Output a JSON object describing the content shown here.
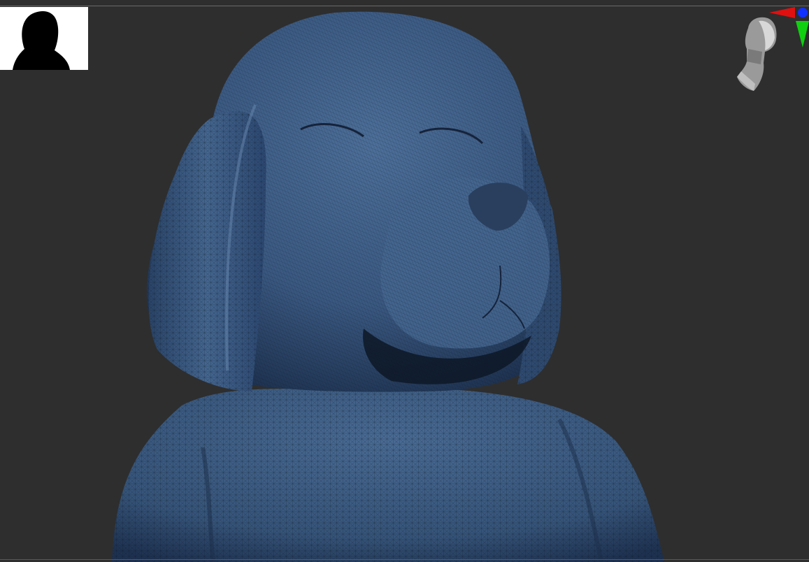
{
  "app": {
    "viewport": "3d-sculpt-viewport"
  },
  "model": {
    "subject": "dog-bust-sculpt",
    "display_mode": "polyframe-wireframe",
    "base_color": "#3c5a80",
    "wire_color": "#0b1726"
  },
  "silhouette_thumbnail": {
    "background": "#ffffff",
    "shape_color": "#000000"
  },
  "navigation_gizmo": {
    "icon": "head-orientation-icon",
    "axis_colors": {
      "x": "#e01010",
      "y": "#10d010",
      "z": "#1030ff"
    }
  },
  "colors": {
    "viewport_bg": "#2e2e2e"
  }
}
